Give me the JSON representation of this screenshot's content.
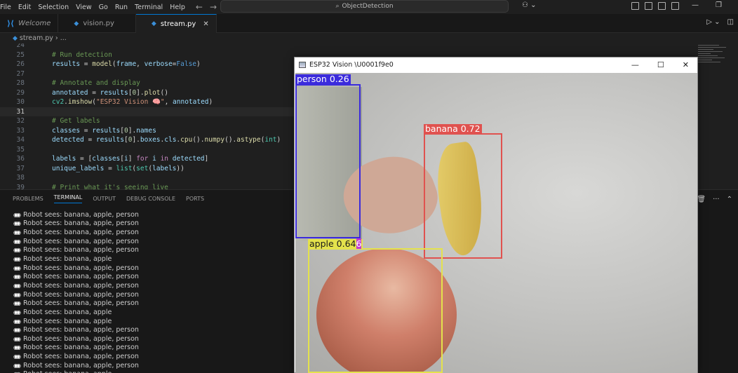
{
  "menu": [
    "File",
    "Edit",
    "Selection",
    "View",
    "Go",
    "Run",
    "Terminal",
    "Help"
  ],
  "search": {
    "text": "ObjectDetection"
  },
  "tabs": [
    {
      "label": "Welcome"
    },
    {
      "label": "vision.py"
    },
    {
      "label": "stream.py"
    }
  ],
  "breadcrumb": {
    "file": "stream.py",
    "rest": "..."
  },
  "code": {
    "lines": [
      {
        "n": "24",
        "html": ""
      },
      {
        "n": "25",
        "html": "<span class='cm'># Run detection</span>"
      },
      {
        "n": "26",
        "html": "<span class='var'>results</span> = <span class='fn'>model</span>(<span class='var'>frame</span>, <span class='var'>verbose</span>=<span class='const'>False</span>)"
      },
      {
        "n": "27",
        "html": ""
      },
      {
        "n": "28",
        "html": "<span class='cm'># Annotate and display</span>"
      },
      {
        "n": "29",
        "html": "<span class='var'>annotated</span> = <span class='var'>results</span>[<span class='num'>0</span>].<span class='fn'>plot</span>()"
      },
      {
        "n": "30",
        "html": "<span class='cls'>cv2</span>.<span class='fn'>imshow</span>(<span class='str'>\"ESP32 Vision 🧠\"</span>, <span class='var'>annotated</span>)"
      },
      {
        "n": "31",
        "html": ""
      },
      {
        "n": "32",
        "html": "<span class='cm'># Get labels</span>"
      },
      {
        "n": "33",
        "html": "<span class='var'>classes</span> = <span class='var'>results</span>[<span class='num'>0</span>].<span class='var'>names</span>"
      },
      {
        "n": "34",
        "html": "<span class='var'>detected</span> = <span class='var'>results</span>[<span class='num'>0</span>].<span class='var'>boxes</span>.<span class='var'>cls</span>.<span class='fn'>cpu</span>().<span class='fn'>numpy</span>().<span class='fn'>astype</span>(<span class='cls'>int</span>)"
      },
      {
        "n": "35",
        "html": ""
      },
      {
        "n": "36",
        "html": "<span class='var'>labels</span> = [<span class='var'>classes</span>[<span class='var'>i</span>] <span class='kw'>for</span> <span class='var'>i</span> <span class='kw'>in</span> <span class='var'>detected</span>]"
      },
      {
        "n": "37",
        "html": "<span class='var'>unique_labels</span> = <span class='cls'>list</span>(<span class='cls'>set</span>(<span class='var'>labels</span>))"
      },
      {
        "n": "38",
        "html": ""
      },
      {
        "n": "39",
        "html": "<span class='cm'># Print what it's seeing live</span>"
      }
    ],
    "current_line": "31"
  },
  "panel": {
    "tabs": [
      "PROBLEMS",
      "TERMINAL",
      "OUTPUT",
      "DEBUG CONSOLE",
      "PORTS"
    ],
    "active_tab": "TERMINAL"
  },
  "terminal": {
    "lines": [
      "Robot sees: banana, apple, person",
      "Robot sees: banana, apple, person",
      "Robot sees: banana, apple, person",
      "Robot sees: banana, apple, person",
      "Robot sees: banana, apple, person",
      "Robot sees: banana, apple",
      "Robot sees: banana, apple, person",
      "Robot sees: banana, apple, person",
      "Robot sees: banana, apple, person",
      "Robot sees: banana, apple, person",
      "Robot sees: banana, apple, person",
      "Robot sees: banana, apple",
      "Robot sees: banana, apple",
      "Robot sees: banana, apple, person",
      "Robot sees: banana, apple, person",
      "Robot sees: banana, apple, person",
      "Robot sees: banana, apple, person",
      "Robot sees: banana, apple, person",
      "Robot sees: banana, apple"
    ]
  },
  "cv_window": {
    "title": "ESP32 Vision \\U0001f9e0",
    "detections": [
      {
        "label": "person 0.26",
        "color": "#3b2bdc"
      },
      {
        "label": "banana 0.72",
        "color": "#e0524f"
      },
      {
        "label": "apple 0.64",
        "color": "#e4e24c"
      }
    ],
    "stray_label_fragment": "6"
  },
  "colors": {
    "accent": "#0078d4",
    "background": "#1f1f1f"
  }
}
